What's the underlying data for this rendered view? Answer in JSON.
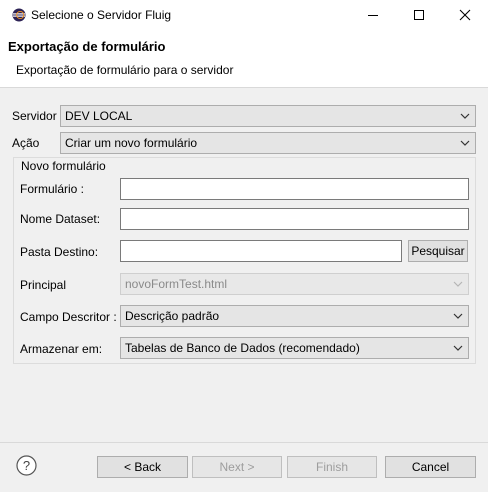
{
  "window": {
    "title": "Selecione o Servidor Fluig",
    "icon": "eclipse-app-icon"
  },
  "header": {
    "title": "Exportação de formulário",
    "subtitle": "Exportação de formulário para o servidor"
  },
  "form": {
    "servidor": {
      "label": "Servidor",
      "value": "DEV LOCAL"
    },
    "acao": {
      "label": "Ação",
      "value": "Criar um novo formulário"
    },
    "group_title": "Novo formulário",
    "formulario": {
      "label": "Formulário :",
      "value": ""
    },
    "nome_dataset": {
      "label": "Nome Dataset:",
      "value": ""
    },
    "pasta_destino": {
      "label": "Pasta Destino:",
      "value": "",
      "button": "Pesquisar"
    },
    "principal": {
      "label": "Principal",
      "value": "novoFormTest.html"
    },
    "campo_descritor": {
      "label": "Campo Descritor :",
      "value": "Descrição padrão"
    },
    "armazenar_em": {
      "label": "Armazenar em:",
      "value": "Tabelas de Banco de Dados (recomendado)"
    }
  },
  "footer": {
    "back": "< Back",
    "next": "Next >",
    "finish": "Finish",
    "cancel": "Cancel"
  }
}
